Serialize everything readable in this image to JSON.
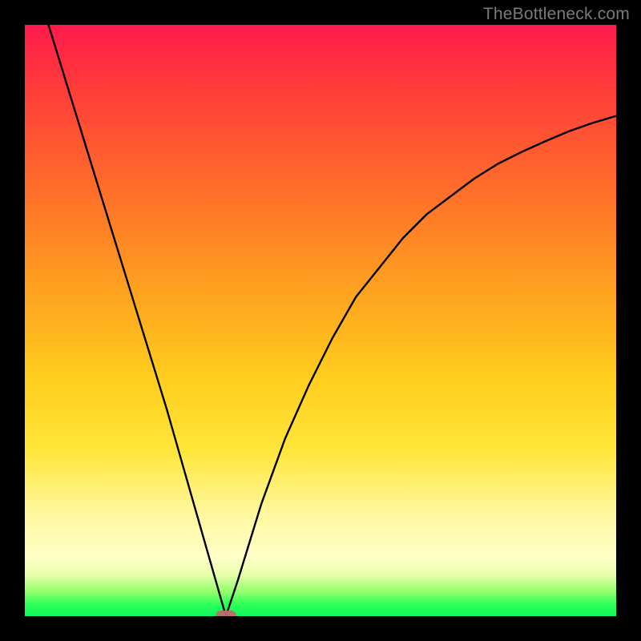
{
  "watermark": "TheBottleneck.com",
  "chart_data": {
    "type": "line",
    "title": "",
    "xlabel": "",
    "ylabel": "",
    "xlim": [
      0,
      100
    ],
    "ylim": [
      0,
      100
    ],
    "grid": false,
    "legend": false,
    "description": "Bottleneck percentage curve: V-shaped line where value drops from ~100 at x≈4 to ~0 at x≈34, then rises asymptotically toward ~85 as x→100. Background is a red→yellow→green vertical gradient (red=high bottleneck, green=low).",
    "series": [
      {
        "name": "bottleneck",
        "x": [
          4,
          8,
          12,
          16,
          20,
          24,
          28,
          32,
          34,
          36,
          40,
          44,
          48,
          52,
          56,
          60,
          64,
          68,
          72,
          76,
          80,
          84,
          88,
          92,
          96,
          100
        ],
        "y": [
          100,
          87,
          74,
          61,
          48,
          35,
          21,
          7,
          0,
          6,
          19,
          30,
          39,
          47,
          54,
          59,
          64,
          68,
          71,
          74,
          76.5,
          78.5,
          80.3,
          82,
          83.4,
          84.6
        ]
      }
    ],
    "marker": {
      "x": 34,
      "y": 0
    },
    "gradient_stops": [
      {
        "pct": 0,
        "color": "#ff1a4d"
      },
      {
        "pct": 10,
        "color": "#ff3a3a"
      },
      {
        "pct": 28,
        "color": "#ff6e2a"
      },
      {
        "pct": 45,
        "color": "#ffa21f"
      },
      {
        "pct": 60,
        "color": "#ffce1e"
      },
      {
        "pct": 72,
        "color": "#ffe63a"
      },
      {
        "pct": 82,
        "color": "#fff69a"
      },
      {
        "pct": 90,
        "color": "#ffffc8"
      },
      {
        "pct": 93,
        "color": "#e8ffa8"
      },
      {
        "pct": 96,
        "color": "#8dff6a"
      },
      {
        "pct": 98,
        "color": "#2cff58"
      },
      {
        "pct": 100,
        "color": "#0ef85c"
      }
    ]
  }
}
